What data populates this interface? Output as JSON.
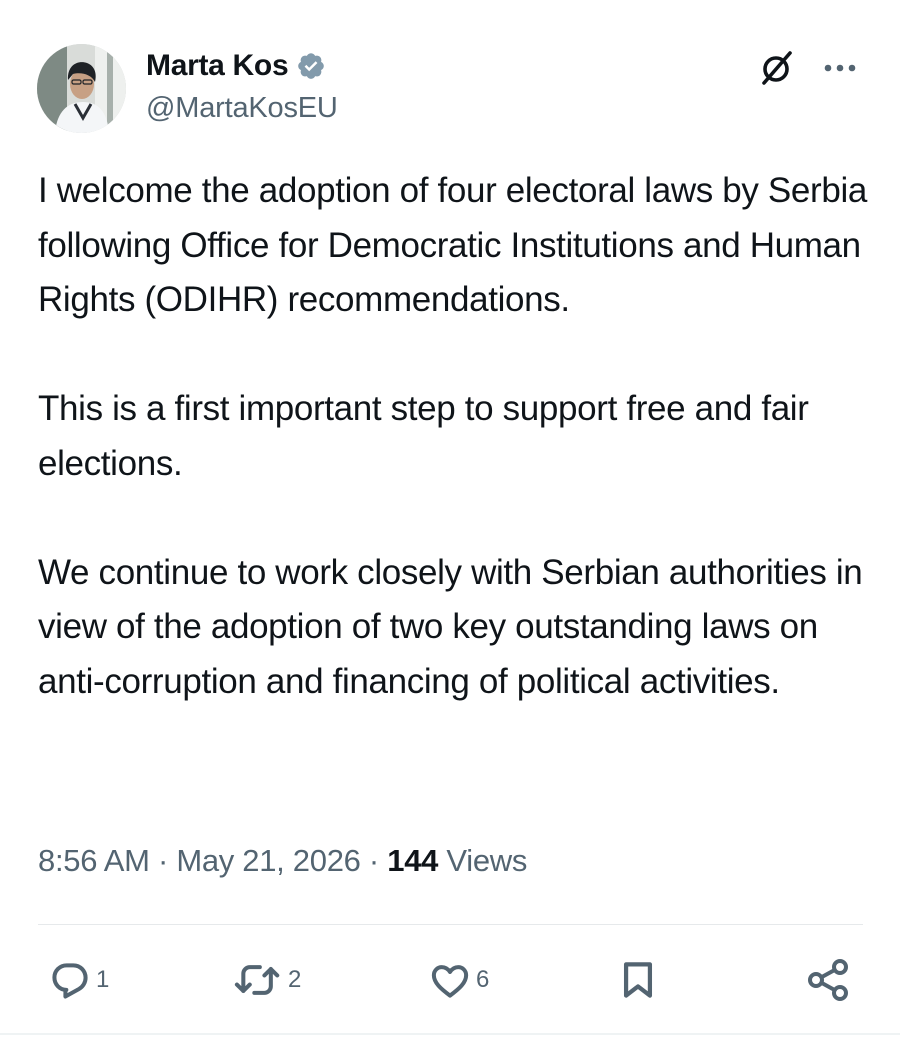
{
  "author": {
    "display_name": "Marta Kos",
    "handle": "@MartaKosEU",
    "verified": true
  },
  "tweet": {
    "paragraphs": [
      "I welcome the adoption of four electoral laws by Serbia following Office for Democratic Institutions and Human Rights (ODIHR) recommendations.",
      "This is a first important step to support free and fair elections.",
      "We continue to work closely with Serbian authorities in view of the adoption of two key outstanding laws on anti-corruption and financing of political activities."
    ],
    "time": "8:56 AM",
    "date": "May 21, 2026",
    "separator": "·",
    "views_count": "144",
    "views_label": "Views"
  },
  "actions": {
    "replies": "1",
    "reposts": "2",
    "likes": "6"
  },
  "icons": {
    "verified": "verified-badge-icon",
    "grok": "grok-icon",
    "more": "more-dots-icon",
    "reply": "reply-icon",
    "repost": "repost-icon",
    "like": "heart-icon",
    "bookmark": "bookmark-icon",
    "share": "share-icon"
  },
  "colors": {
    "text_primary": "#0f1419",
    "text_secondary": "#536471",
    "verified_badge": "#829aab",
    "divider": "#e6e9eb"
  }
}
